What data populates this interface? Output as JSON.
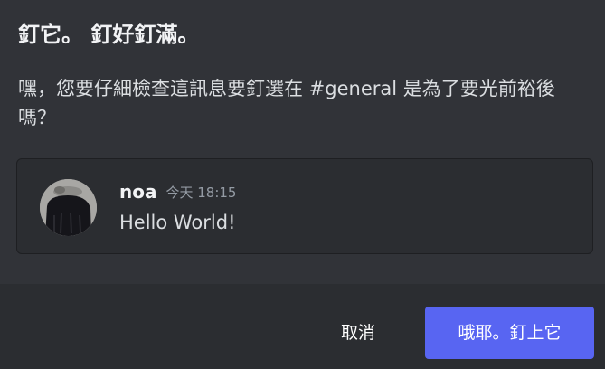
{
  "modal": {
    "title": "釘它。 釘好釘滿。",
    "description": "嘿，您要仔細檢查這訊息要釘選在 #general 是為了要光前裕後嗎？"
  },
  "message": {
    "author": "noa",
    "timestamp": "今天 18:15",
    "content": "Hello World!"
  },
  "footer": {
    "cancel_label": "取消",
    "confirm_label": "哦耶。釘上它"
  },
  "colors": {
    "background": "#313338",
    "footer_background": "#2b2d31",
    "preview_background": "#2b2d31",
    "primary_button": "#5865f2",
    "title_text": "#f2f3f5",
    "muted_text": "#949ba4"
  }
}
